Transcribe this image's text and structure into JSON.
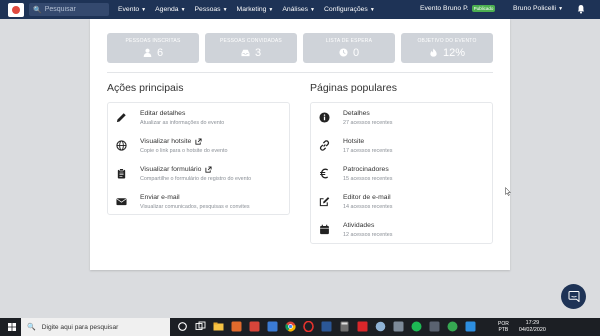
{
  "navbar": {
    "search_placeholder": "Pesquisar",
    "menu": [
      "Evento",
      "Agenda",
      "Pessoas",
      "Marketing",
      "Análises",
      "Configurações"
    ],
    "event_name": "Evento Bruno P.",
    "event_badge": "Publicado",
    "user_name": "Bruno Policelli",
    "bg_color": "#1e3356"
  },
  "stats": [
    {
      "label": "PESSOAS INSCRITAS",
      "value": "6",
      "icon": "user-icon"
    },
    {
      "label": "PESSOAS CONVIDADAS",
      "value": "3",
      "icon": "inbox-icon"
    },
    {
      "label": "LISTA DE ESPERA",
      "value": "0",
      "icon": "clock-icon"
    },
    {
      "label": "OBJETIVO DO EVENTO",
      "value": "12%",
      "icon": "fire-icon"
    }
  ],
  "acoes": {
    "title": "Ações principais",
    "items": [
      {
        "title": "Editar detalhes",
        "subtitle": "Atualizar as informações do evento",
        "icon": "pencil-icon"
      },
      {
        "title": "Visualizar hotsite",
        "subtitle": "Copie o link para o hotsite do evento",
        "icon": "globe-icon"
      },
      {
        "title": "Visualizar formulário",
        "subtitle": "Compartilhe o formulário de registro do evento",
        "icon": "clipboard-icon"
      },
      {
        "title": "Enviar e-mail",
        "subtitle": "Visualizar comunicados, pesquisas e convites",
        "icon": "envelope-icon"
      }
    ]
  },
  "paginas": {
    "title": "Páginas populares",
    "items": [
      {
        "title": "Detalhes",
        "subtitle": "27 acessos recentes",
        "icon": "info-icon"
      },
      {
        "title": "Hotsite",
        "subtitle": "17 acessos recentes",
        "icon": "link-icon"
      },
      {
        "title": "Patrocinadores",
        "subtitle": "15 acessos recentes",
        "icon": "euro-icon"
      },
      {
        "title": "Editor de e-mail",
        "subtitle": "14 acessos recentes",
        "icon": "edit-icon"
      },
      {
        "title": "Atividades",
        "subtitle": "12 acessos recentes",
        "icon": "calendar-icon"
      }
    ]
  },
  "taskbar": {
    "search_placeholder": "Digite aqui para pesquisar",
    "lang_1": "POR",
    "lang_2": "PTB",
    "time": "17:29",
    "date": "04/02/2020"
  }
}
